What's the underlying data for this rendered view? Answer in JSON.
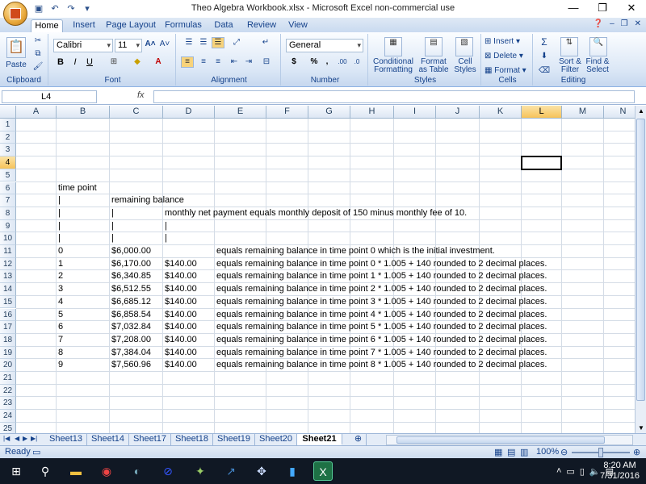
{
  "window": {
    "title": "Theo Algebra Workbook.xlsx - Microsoft Excel non-commercial use",
    "controls": [
      "—",
      "❐",
      "✕"
    ]
  },
  "quick_access": [
    "save-icon",
    "undo-icon",
    "redo-icon"
  ],
  "ribbon_tabs": [
    "Home",
    "Insert",
    "Page Layout",
    "Formulas",
    "Data",
    "Review",
    "View"
  ],
  "ribbon": {
    "clipboard": {
      "label": "Clipboard",
      "paste": "Paste"
    },
    "font": {
      "label": "Font",
      "name": "Calibri",
      "size": "11",
      "bold": "B",
      "italic": "I",
      "underline": "U"
    },
    "alignment": {
      "label": "Alignment"
    },
    "number": {
      "label": "Number",
      "format": "General",
      "currency": "$",
      "percent": "%",
      "comma": ","
    },
    "styles": {
      "label": "Styles",
      "conditional": "Conditional Formatting",
      "format_table": "Format as Table",
      "cell_styles": "Cell Styles"
    },
    "cells": {
      "label": "Cells",
      "insert": "Insert",
      "delete": "Delete",
      "format": "Format"
    },
    "editing": {
      "label": "Editing",
      "sort": "Sort & Filter",
      "find": "Find & Select"
    }
  },
  "formula_bar": {
    "name_box": "L4",
    "fx": "fx",
    "formula": ""
  },
  "columns": [
    "A",
    "B",
    "C",
    "D",
    "E",
    "F",
    "G",
    "H",
    "I",
    "J",
    "K",
    "L",
    "M",
    "N"
  ],
  "selected_column": "L",
  "selected_row": 4,
  "rows": [
    "1",
    "2",
    "3",
    "4",
    "5",
    "6",
    "7",
    "8",
    "9",
    "10",
    "11",
    "12",
    "13",
    "14",
    "15",
    "16",
    "17",
    "18",
    "19",
    "20",
    "21",
    "22",
    "23",
    "24",
    "25"
  ],
  "cells": {
    "B6": "time point",
    "B7": "|",
    "C7": "remaining balance",
    "B8": "|",
    "C8": "|",
    "D8": "monthly net payment equals monthly deposit of 150 minus monthly fee of 10.",
    "B9": "|",
    "C9": "|",
    "D9": "|",
    "B10": "|",
    "C10": "|",
    "D10": "|",
    "B11": "0",
    "C11": "$6,000.00",
    "E11": "equals remaining balance in time point 0 which is the initial investment.",
    "B12": "1",
    "C12": "$6,170.00",
    "D12": "$140.00",
    "E12": "equals remaining balance in time point  0 * 1.005 + 140 rounded to 2 decimal places.",
    "B13": "2",
    "C13": "$6,340.85",
    "D13": "$140.00",
    "E13": "equals remaining balance in time point  1 * 1.005 + 140 rounded to 2 decimal places.",
    "B14": "3",
    "C14": "$6,512.55",
    "D14": "$140.00",
    "E14": "equals remaining balance in time point  2 * 1.005 + 140 rounded to 2 decimal places.",
    "B15": "4",
    "C15": "$6,685.12",
    "D15": "$140.00",
    "E15": "equals remaining balance in time point  3 * 1.005 + 140 rounded to 2 decimal places.",
    "B16": "5",
    "C16": "$6,858.54",
    "D16": "$140.00",
    "E16": "equals remaining balance in time point  4 * 1.005 + 140 rounded to 2 decimal places.",
    "B17": "6",
    "C17": "$7,032.84",
    "D17": "$140.00",
    "E17": "equals remaining balance in time point  5 * 1.005 + 140 rounded to 2 decimal places.",
    "B18": "7",
    "C18": "$7,208.00",
    "D18": "$140.00",
    "E18": "equals remaining balance in time point  6 * 1.005 + 140 rounded to 2 decimal places.",
    "B19": "8",
    "C19": "$7,384.04",
    "D19": "$140.00",
    "E19": "equals remaining balance in time point  7 * 1.005 + 140 rounded to 2 decimal places.",
    "B20": "9",
    "C20": "$7,560.96",
    "D20": "$140.00",
    "E20": "equals remaining balance in time point  8 * 1.005 + 140 rounded to 2 decimal places."
  },
  "sheet_tabs": [
    "Sheet13",
    "Sheet14",
    "Sheet17",
    "Sheet18",
    "Sheet19",
    "Sheet20",
    "Sheet21"
  ],
  "active_sheet": "Sheet21",
  "status": {
    "mode": "Ready",
    "zoom": "100%"
  },
  "taskbar": {
    "time": "8:20 AM",
    "date": "7/31/2016"
  }
}
